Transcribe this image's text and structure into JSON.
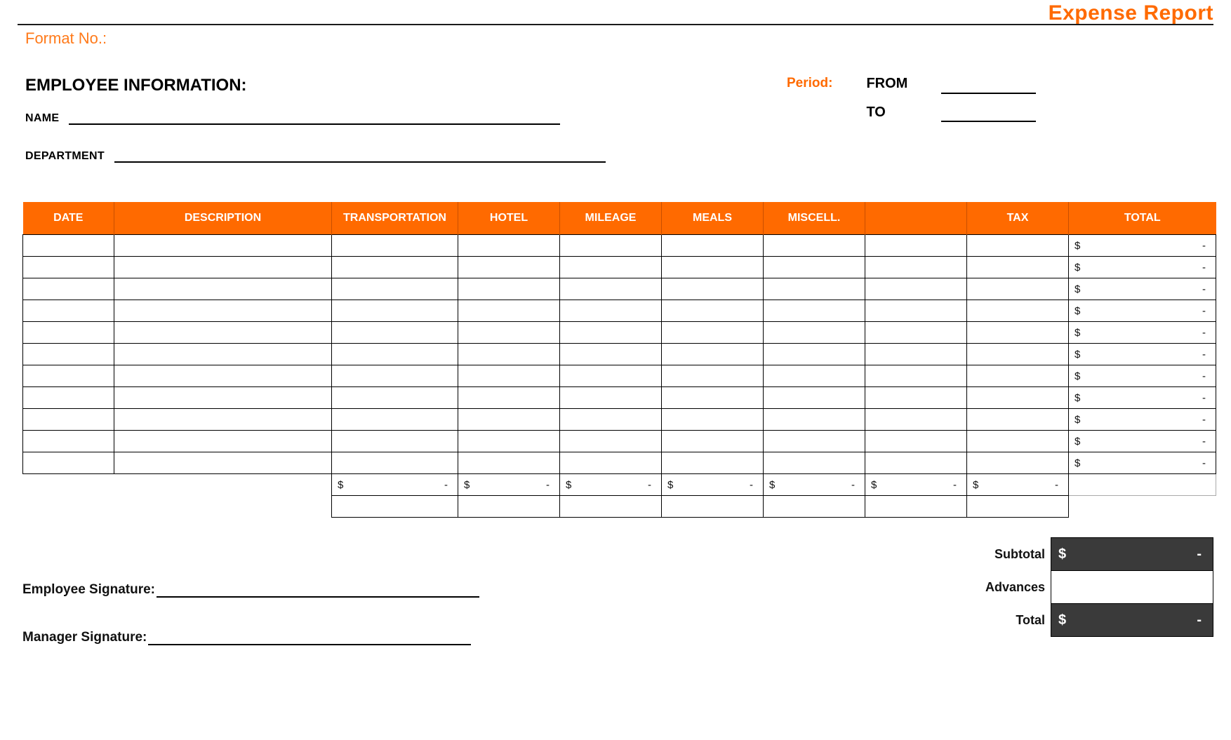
{
  "title": "Expense Report",
  "format_no_label": "Format No.:",
  "employee_info_heading": "EMPLOYEE INFORMATION:",
  "name_label": "NAME",
  "department_label": "DEPARTMENT",
  "period_label": "Period:",
  "from_label": "FROM",
  "to_label": "TO",
  "columns": {
    "date": "DATE",
    "description": "DESCRIPTION",
    "transportation": "TRANSPORTATION",
    "hotel": "HOTEL",
    "mileage": "MILEAGE",
    "meals": "MEALS",
    "miscell": "MISCELL.",
    "blank": "",
    "tax": "TAX",
    "total": "TOTAL"
  },
  "row_total_currency": "$",
  "row_total_value": "-",
  "row_count": 11,
  "column_totals": {
    "currency": "$",
    "transportation": "-",
    "hotel": "-",
    "mileage": "-",
    "meals": "-",
    "miscell": "-",
    "blank": "-",
    "tax": "-"
  },
  "summary": {
    "subtotal_label": "Subtotal",
    "advances_label": "Advances",
    "total_label": "Total",
    "currency": "$",
    "subtotal_value": "-",
    "advances_value": "",
    "total_value": "-"
  },
  "signatures": {
    "employee_label": "Employee Signature:",
    "manager_label": "Manager Signature:"
  }
}
